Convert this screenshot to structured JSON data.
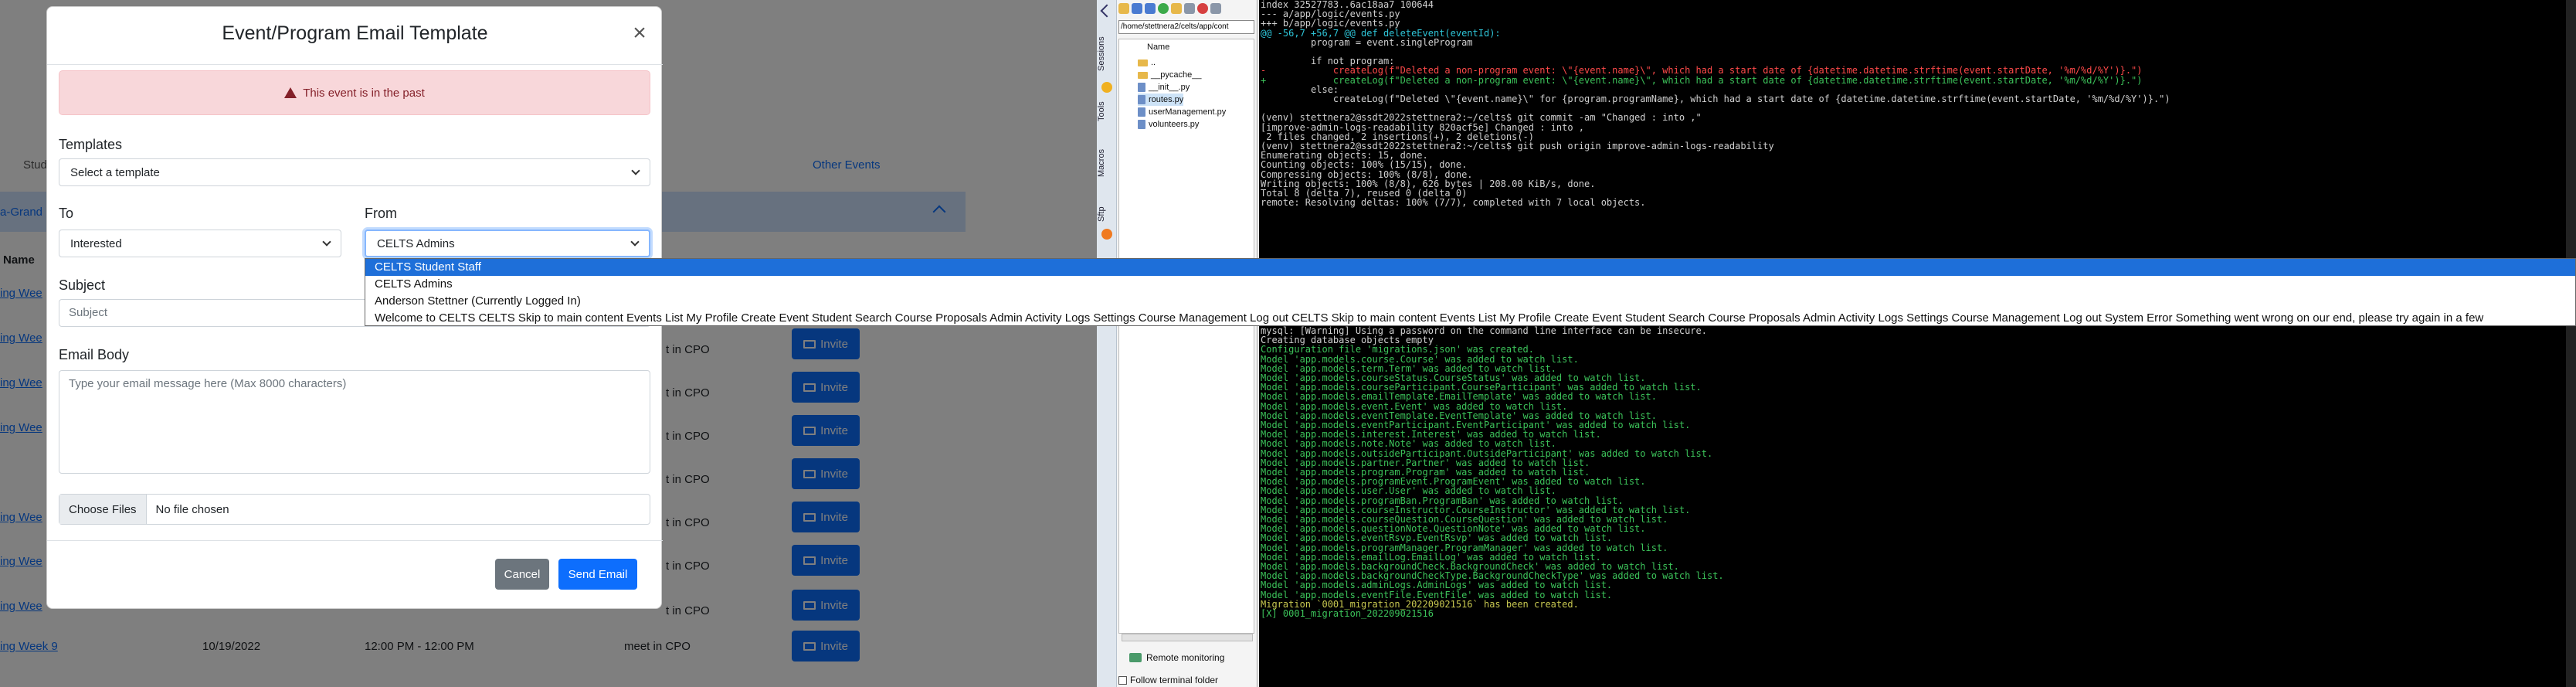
{
  "background_page": {
    "tab_students": "Stud",
    "tab_other_events": "Other Events",
    "section_title": "a-Grand",
    "col_name": "Name",
    "rows": [
      {
        "name": "ing Wee"
      },
      {
        "name": "ing Wee"
      },
      {
        "name": "ing Wee"
      },
      {
        "name": "ing Wee"
      },
      {
        "name": "ing Wee"
      },
      {
        "name": "ing Wee"
      },
      {
        "name": "ing Wee"
      },
      {
        "name": "ing Week 9",
        "date": "10/19/2022",
        "time": "12:00 PM - 12:00 PM",
        "location": "meet in CPO"
      }
    ],
    "location_text": "t in CPO",
    "invite_label": "Invite"
  },
  "modal": {
    "title": "Event/Program Email Template",
    "alert": "This event is in the past",
    "templates_label": "Templates",
    "templates_value": "Select a template",
    "to_label": "To",
    "to_value": "Interested",
    "from_label": "From",
    "from_value": "CELTS Admins",
    "subject_label": "Subject",
    "subject_placeholder": "Subject",
    "body_label": "Email Body",
    "body_placeholder": "Type your email message here (Max 8000 characters)",
    "choose_files": "Choose Files",
    "no_file": "No file chosen",
    "cancel": "Cancel",
    "send": "Send Email"
  },
  "from_dropdown": {
    "options": [
      "CELTS Student Staff",
      "CELTS Admins",
      "Anderson Stettner (Currently Logged In)",
      "Welcome to CELTS CELTS Skip to main content Events List My Profile Create Event Student Search Course Proposals Admin Activity Logs Settings Course Management Log out CELTS Skip to main content Events List My Profile Create Event Student Search Course Proposals Admin Activity Logs Settings Course Management Log out System Error Something went wrong on our end, please try again in a few"
    ],
    "selected_index": 0
  },
  "terminal_app": {
    "side_tabs": [
      "Sessions",
      "Tools",
      "Macros",
      "Sftp"
    ],
    "path": "/home/stettnera2/celts/app/cont",
    "tree_header": "Name",
    "tree": [
      "..",
      "__pycache__",
      "__init__.py",
      "routes.py",
      "userManagement.py",
      "volunteers.py"
    ],
    "remote_monitoring": "Remote monitoring",
    "follow_folder": "Follow terminal folder"
  },
  "terminal_top": [
    {
      "c": "",
      "t": "index 32527783..6ac18aa7 100644"
    },
    {
      "c": "",
      "t": "--- a/app/logic/events.py"
    },
    {
      "c": "",
      "t": "+++ b/app/logic/events.py"
    },
    {
      "c": "cyn",
      "t": "@@ -56,7 +56,7 @@ def deleteEvent(eventId):"
    },
    {
      "c": "",
      "t": "         program = event.singleProgram"
    },
    {
      "c": "",
      "t": ""
    },
    {
      "c": "",
      "t": "         if not program:"
    },
    {
      "c": "red",
      "t": "-            createLog(f\"Deleted a non-program event: \\\"{event.name}\\\", which had a start date of {datetime.datetime.strftime(event.startDate, '%m/%d/%Y')}.\")"
    },
    {
      "c": "grn",
      "t": "+            createLog(f\"Deleted a non-program event: \\\"{event.name}\\\", which had a start date of {datetime.datetime.strftime(event.startDate, '%m/%d/%Y')}.\")"
    },
    {
      "c": "",
      "t": "         else:"
    },
    {
      "c": "",
      "t": "             createLog(f\"Deleted \\\"{event.name}\\\" for {program.programName}, which had a start date of {datetime.datetime.strftime(event.startDate, '%m/%d/%Y')}.\")"
    },
    {
      "c": "",
      "t": ""
    },
    {
      "c": "",
      "t": "(venv) stettnera2@ssdt2022stettnera2:~/celts$ git commit -am \"Changed : into ,\""
    },
    {
      "c": "",
      "t": "[improve-admin-logs-readability 820acf5e] Changed : into ,"
    },
    {
      "c": "",
      "t": " 2 files changed, 2 insertions(+), 2 deletions(-)"
    },
    {
      "c": "",
      "t": "(venv) stettnera2@ssdt2022stettnera2:~/celts$ git push origin improve-admin-logs-readability"
    },
    {
      "c": "",
      "t": "Enumerating objects: 15, done."
    },
    {
      "c": "",
      "t": "Counting objects: 100% (15/15), done."
    },
    {
      "c": "",
      "t": "Compressing objects: 100% (8/8), done."
    },
    {
      "c": "",
      "t": "Writing objects: 100% (8/8), 626 bytes | 208.00 KiB/s, done."
    },
    {
      "c": "",
      "t": "Total 8 (delta 7), reused 0 (delta 0)"
    },
    {
      "c": "",
      "t": "remote: Resolving deltas: 100% (7/7), completed with 7 local objects."
    }
  ],
  "terminal_bottom": [
    {
      "c": "",
      "t": "mysql: [Warning] Using a password on the command line interface can be insecure."
    },
    {
      "c": "",
      "t": "Creating database objects empty"
    },
    {
      "c": "grn",
      "t": "Configuration file 'migrations.json' was created."
    },
    {
      "c": "grn",
      "t": "Model 'app.models.course.Course' was added to watch list."
    },
    {
      "c": "grn",
      "t": "Model 'app.models.term.Term' was added to watch list."
    },
    {
      "c": "grn",
      "t": "Model 'app.models.courseStatus.CourseStatus' was added to watch list."
    },
    {
      "c": "grn",
      "t": "Model 'app.models.courseParticipant.CourseParticipant' was added to watch list."
    },
    {
      "c": "grn",
      "t": "Model 'app.models.emailTemplate.EmailTemplate' was added to watch list."
    },
    {
      "c": "grn",
      "t": "Model 'app.models.event.Event' was added to watch list."
    },
    {
      "c": "grn",
      "t": "Model 'app.models.eventTemplate.EventTemplate' was added to watch list."
    },
    {
      "c": "grn",
      "t": "Model 'app.models.eventParticipant.EventParticipant' was added to watch list."
    },
    {
      "c": "grn",
      "t": "Model 'app.models.interest.Interest' was added to watch list."
    },
    {
      "c": "grn",
      "t": "Model 'app.models.note.Note' was added to watch list."
    },
    {
      "c": "grn",
      "t": "Model 'app.models.outsideParticipant.OutsideParticipant' was added to watch list."
    },
    {
      "c": "grn",
      "t": "Model 'app.models.partner.Partner' was added to watch list."
    },
    {
      "c": "grn",
      "t": "Model 'app.models.program.Program' was added to watch list."
    },
    {
      "c": "grn",
      "t": "Model 'app.models.programEvent.ProgramEvent' was added to watch list."
    },
    {
      "c": "grn",
      "t": "Model 'app.models.user.User' was added to watch list."
    },
    {
      "c": "grn",
      "t": "Model 'app.models.programBan.ProgramBan' was added to watch list."
    },
    {
      "c": "grn",
      "t": "Model 'app.models.courseInstructor.CourseInstructor' was added to watch list."
    },
    {
      "c": "grn",
      "t": "Model 'app.models.courseQuestion.CourseQuestion' was added to watch list."
    },
    {
      "c": "grn",
      "t": "Model 'app.models.questionNote.QuestionNote' was added to watch list."
    },
    {
      "c": "grn",
      "t": "Model 'app.models.eventRsvp.EventRsvp' was added to watch list."
    },
    {
      "c": "grn",
      "t": "Model 'app.models.programManager.ProgramManager' was added to watch list."
    },
    {
      "c": "grn",
      "t": "Model 'app.models.emailLog.EmailLog' was added to watch list."
    },
    {
      "c": "grn",
      "t": "Model 'app.models.backgroundCheck.BackgroundCheck' was added to watch list."
    },
    {
      "c": "grn",
      "t": "Model 'app.models.backgroundCheckType.BackgroundCheckType' was added to watch list."
    },
    {
      "c": "grn",
      "t": "Model 'app.models.adminLogs.AdminLogs' was added to watch list."
    },
    {
      "c": "grn",
      "t": "Model 'app.models.eventFile.EventFile' was added to watch list."
    },
    {
      "c": "ylw",
      "t": "Migration `0001_migration_202209021516` has been created."
    },
    {
      "c": "grn",
      "t": "[X] 0001_migration_202209021516"
    }
  ],
  "colors": {
    "primary": "#0d6efd",
    "danger_bg": "#f8d7da",
    "danger_text": "#842029",
    "terminal_bg": "#000000",
    "highlight": "#1e6fd9"
  }
}
